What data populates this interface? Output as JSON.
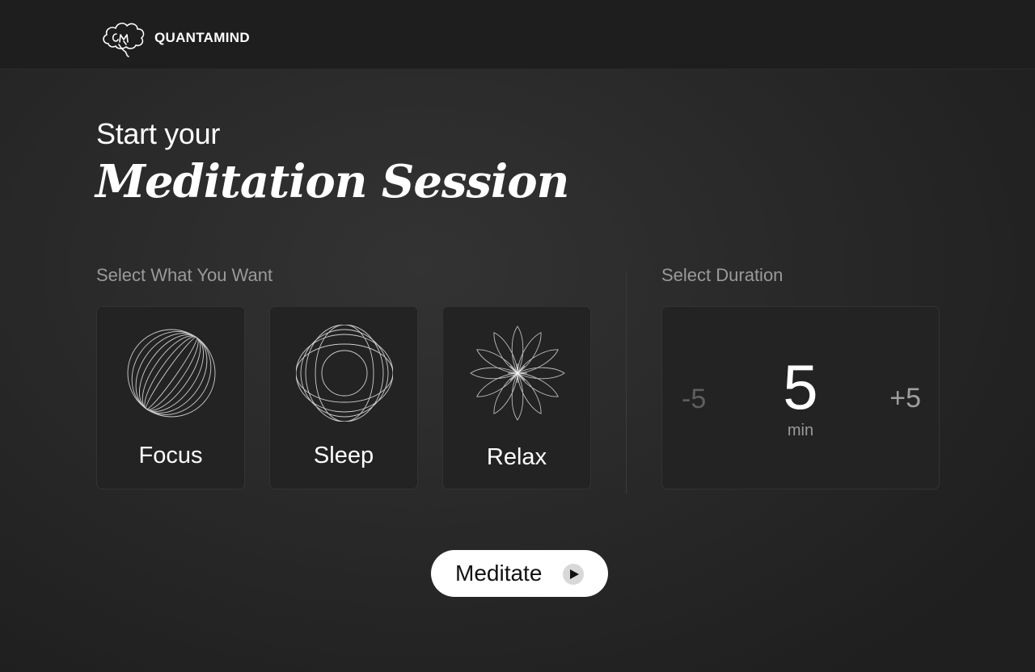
{
  "header": {
    "brand": "QUANTAMIND",
    "logo_icon": "brain-qm-logo-icon"
  },
  "hero": {
    "subtitle": "Start your",
    "title": "Meditation Session"
  },
  "modes": {
    "label": "Select What You Want",
    "items": [
      {
        "label": "Focus",
        "icon": "sphere-lines-icon"
      },
      {
        "label": "Sleep",
        "icon": "orbit-rings-icon"
      },
      {
        "label": "Relax",
        "icon": "lotus-flower-icon"
      }
    ]
  },
  "duration": {
    "label": "Select Duration",
    "decrement": "-5",
    "increment": "+5",
    "value": "5",
    "unit": "min"
  },
  "action": {
    "label": "Meditate",
    "icon": "play-icon"
  },
  "colors": {
    "background": "#2a2a2a",
    "card": "#232323",
    "muted_text": "#9a9a9a",
    "button": "#ffffff"
  }
}
